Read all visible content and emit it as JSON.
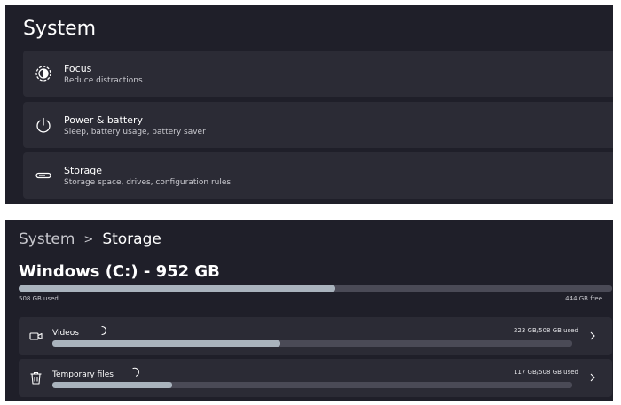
{
  "system_settings": {
    "title": "System",
    "items": [
      {
        "title": "Focus",
        "subtitle": "Reduce distractions",
        "icon": "focus-icon"
      },
      {
        "title": "Power & battery",
        "subtitle": "Sleep, battery usage, battery saver",
        "icon": "power-icon"
      },
      {
        "title": "Storage",
        "subtitle": "Storage space, drives, configuration rules",
        "icon": "storage-drive-icon"
      }
    ]
  },
  "storage_page": {
    "breadcrumb": {
      "parent": "System",
      "separator": ">",
      "current": "Storage"
    },
    "drive": {
      "title": "Windows (C:) - 952 GB",
      "used_label": "508 GB used",
      "free_label": "444 GB free",
      "used_fraction": 0.534
    },
    "categories": [
      {
        "label": "Videos",
        "usage": "223 GB/508 GB used",
        "used_fraction": 0.439,
        "icon": "video-camera-icon"
      },
      {
        "label": "Temporary files",
        "usage": "117 GB/508 GB used",
        "used_fraction": 0.23,
        "icon": "trash-icon"
      }
    ]
  },
  "colors": {
    "panel_background": "#1f1f29",
    "card_background": "#2b2b35",
    "bar_fill": "#a9b3bd",
    "bar_track": "#4a4a56"
  }
}
